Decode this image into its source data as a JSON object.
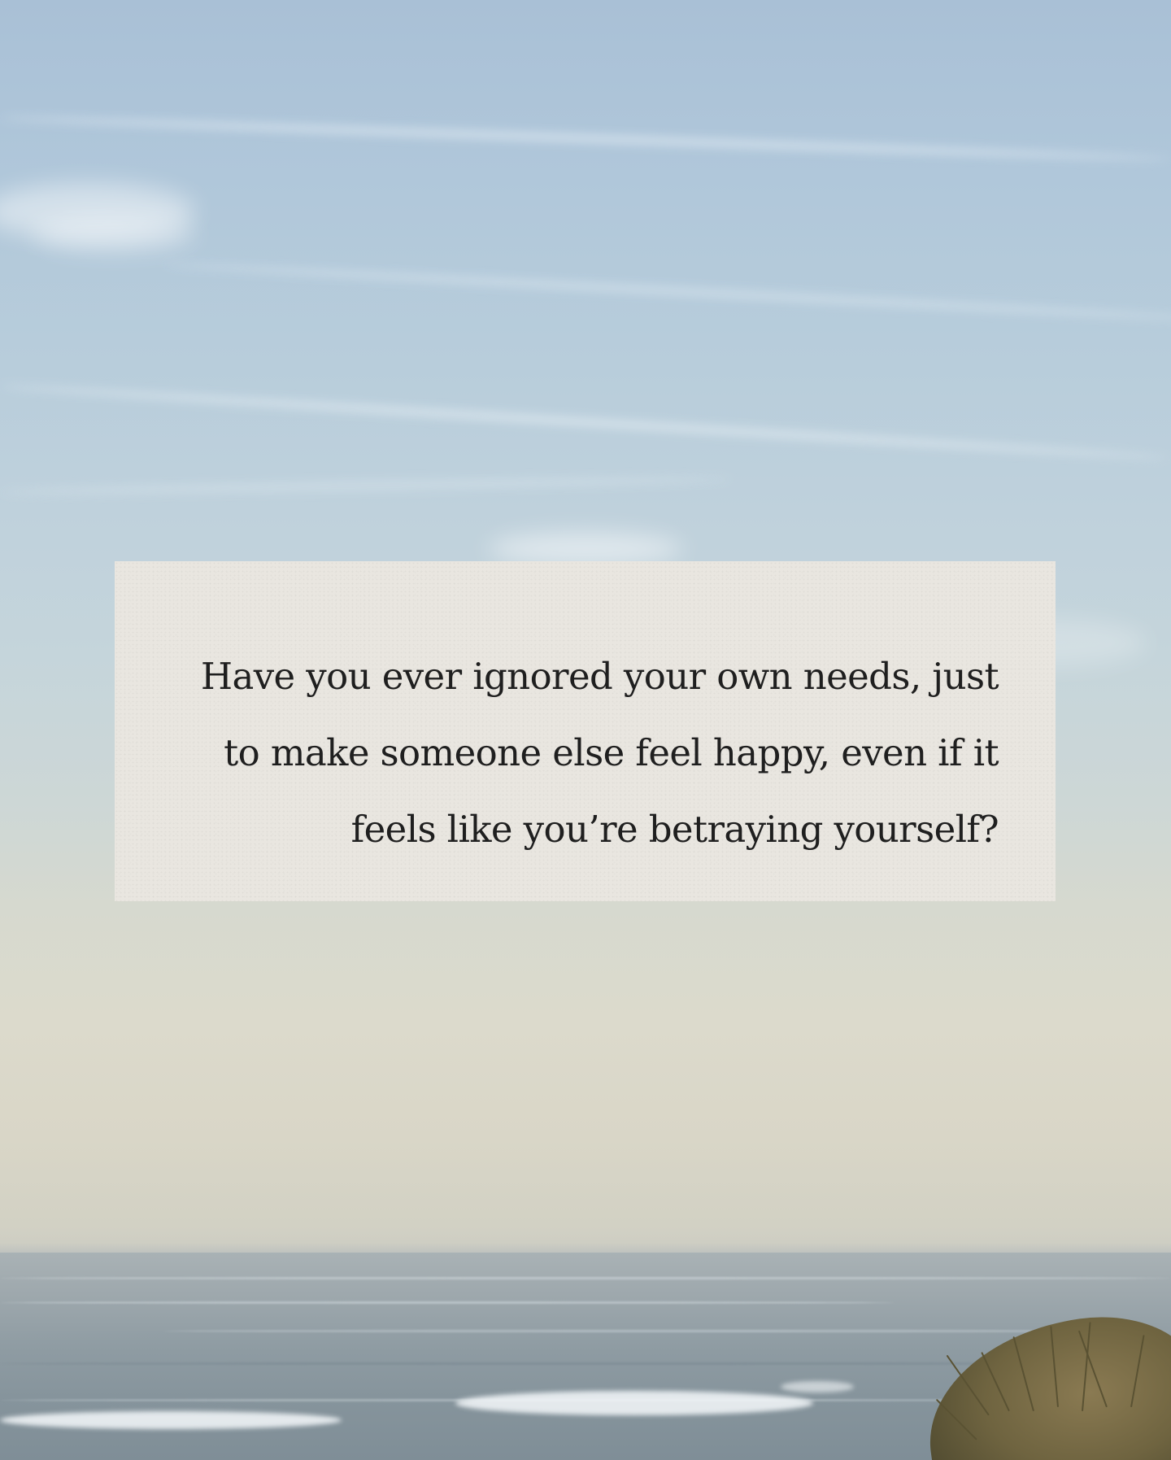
{
  "quote": {
    "lines": [
      "Have you ever ignored your own needs, just",
      "to make someone else feel happy, even if it",
      "feels like you’re betraying yourself?"
    ]
  },
  "colors": {
    "sky_top": "#a9c0d6",
    "sky_bottom": "#dcdacc",
    "sea": "#8f9ca3",
    "paper": "#e9e6e0",
    "text": "#1f1f1f"
  }
}
